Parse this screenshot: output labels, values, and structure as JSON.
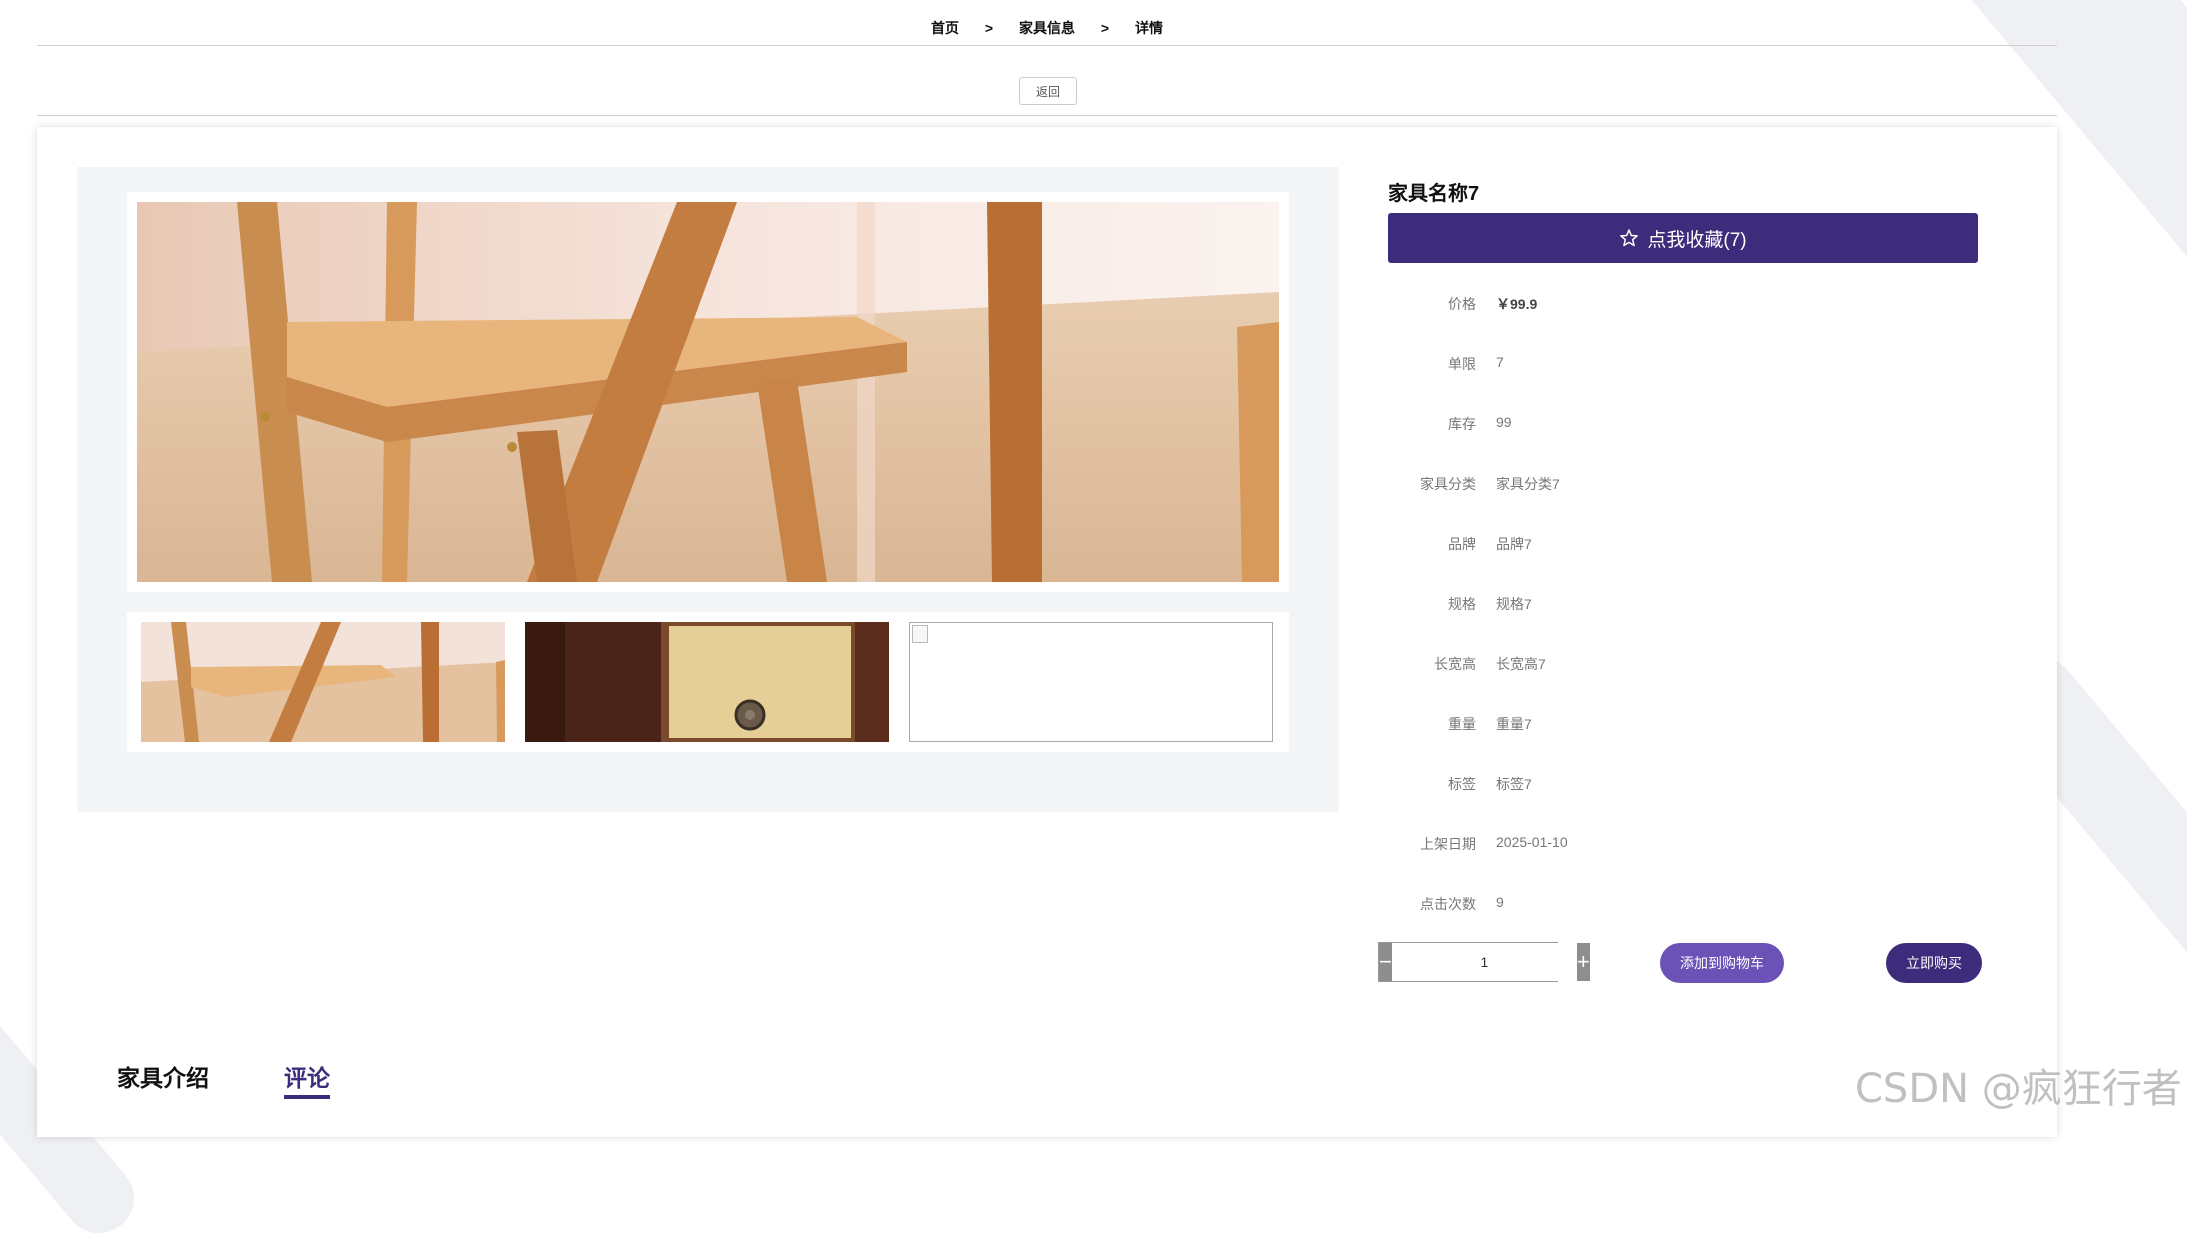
{
  "breadcrumb": {
    "home": "首页",
    "section": "家具信息",
    "current": "详情",
    "separator": ">"
  },
  "back_button": "返回",
  "product": {
    "name": "家具名称7",
    "favorite_label": "点我收藏(7)",
    "fields": [
      {
        "label": "价格",
        "value": "￥99.9"
      },
      {
        "label": "单限",
        "value": "7"
      },
      {
        "label": "库存",
        "value": "99"
      },
      {
        "label": "家具分类",
        "value": "家具分类7"
      },
      {
        "label": "品牌",
        "value": "品牌7"
      },
      {
        "label": "规格",
        "value": "规格7"
      },
      {
        "label": "长宽高",
        "value": "长宽高7"
      },
      {
        "label": "重量",
        "value": "重量7"
      },
      {
        "label": "标签",
        "value": "标签7"
      },
      {
        "label": "上架日期",
        "value": "2025-01-10"
      },
      {
        "label": "点击次数",
        "value": "9"
      }
    ]
  },
  "quantity": {
    "minus": "−",
    "plus": "+",
    "value": "1"
  },
  "actions": {
    "add_to_cart": "添加到购物车",
    "buy_now": "立即购买"
  },
  "tabs": [
    {
      "label": "家具介绍"
    },
    {
      "label": "评论",
      "active": true
    }
  ],
  "watermark": "CSDN @疯狂行者",
  "colors": {
    "primary": "#3d2c7c",
    "secondary": "#6b52b7",
    "gallery_bg": "#f2f4f6"
  }
}
